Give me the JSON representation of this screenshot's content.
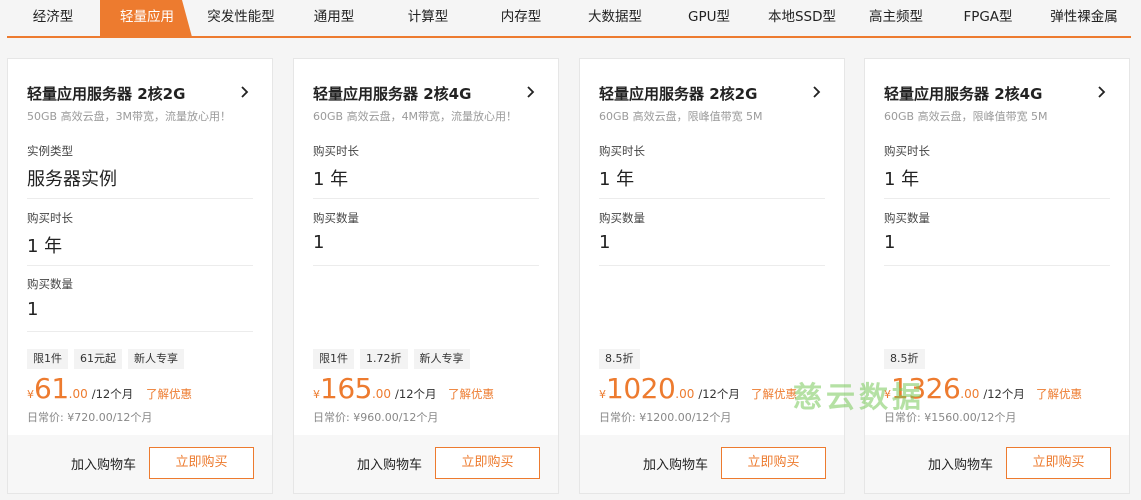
{
  "tabs": [
    {
      "label": "经济型",
      "active": false
    },
    {
      "label": "轻量应用",
      "active": true
    },
    {
      "label": "突发性能型",
      "active": false
    },
    {
      "label": "通用型",
      "active": false
    },
    {
      "label": "计算型",
      "active": false
    },
    {
      "label": "内存型",
      "active": false
    },
    {
      "label": "大数据型",
      "active": false
    },
    {
      "label": "GPU型",
      "active": false
    },
    {
      "label": "本地SSD型",
      "active": false
    },
    {
      "label": "高主频型",
      "active": false
    },
    {
      "label": "FPGA型",
      "active": false
    },
    {
      "label": "弹性裸金属",
      "active": false
    }
  ],
  "colors": {
    "accent": "#ed7b2f",
    "watermark": "#78c85a"
  },
  "icons": {
    "card_arrow": "chevron-right-icon"
  },
  "cards": [
    {
      "title": "轻量应用服务器 2核2G",
      "desc": "50GB 高效云盘，3M带宽，流量放心用！",
      "fields": [
        {
          "label": "实例类型",
          "value": "服务器实例"
        },
        {
          "label": "购买时长",
          "value": "1 年"
        },
        {
          "label": "购买数量",
          "value": "1"
        }
      ],
      "badges": [
        "限1件",
        "61元起",
        "新人专享"
      ],
      "currency": "¥",
      "price_int": "61",
      "price_dec": ".00",
      "period": "/12个月",
      "promo": "了解优惠",
      "normal_price": "日常价: ¥720.00/12个月",
      "cart_label": "加入购物车",
      "buy_label": "立即购买"
    },
    {
      "title": "轻量应用服务器 2核4G",
      "desc": "60GB 高效云盘，4M带宽，流量放心用！",
      "fields": [
        {
          "label": "购买时长",
          "value": "1 年"
        },
        {
          "label": "购买数量",
          "value": "1"
        }
      ],
      "badges": [
        "限1件",
        "1.72折",
        "新人专享"
      ],
      "currency": "¥",
      "price_int": "165",
      "price_dec": ".00",
      "period": "/12个月",
      "promo": "了解优惠",
      "normal_price": "日常价: ¥960.00/12个月",
      "cart_label": "加入购物车",
      "buy_label": "立即购买"
    },
    {
      "title": "轻量应用服务器 2核2G",
      "desc": "60GB 高效云盘，限峰值带宽 5M",
      "fields": [
        {
          "label": "购买时长",
          "value": "1 年"
        },
        {
          "label": "购买数量",
          "value": "1"
        }
      ],
      "badges": [
        "8.5折"
      ],
      "currency": "¥",
      "price_int": "1020",
      "price_dec": ".00",
      "period": "/12个月",
      "promo": "了解优惠",
      "normal_price": "日常价: ¥1200.00/12个月",
      "cart_label": "加入购物车",
      "buy_label": "立即购买"
    },
    {
      "title": "轻量应用服务器 2核4G",
      "desc": "60GB 高效云盘，限峰值带宽 5M",
      "fields": [
        {
          "label": "购买时长",
          "value": "1 年"
        },
        {
          "label": "购买数量",
          "value": "1"
        }
      ],
      "badges": [
        "8.5折"
      ],
      "currency": "¥",
      "price_int": "1326",
      "price_dec": ".00",
      "period": "/12个月",
      "promo": "了解优惠",
      "normal_price": "日常价: ¥1560.00/12个月",
      "cart_label": "加入购物车",
      "buy_label": "立即购买"
    }
  ],
  "watermark": "慈云数据"
}
